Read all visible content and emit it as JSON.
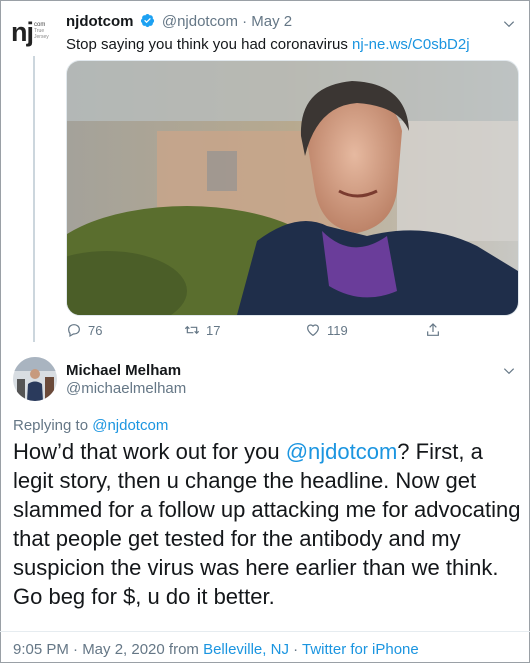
{
  "parent_tweet": {
    "avatar_letters": "nj",
    "avatar_small": "com",
    "avatar_caption": "True Jersey",
    "display_name": "njdotcom",
    "handle": "@njdotcom",
    "separator": "·",
    "date": "May 2",
    "text": "Stop saying you think you had coronavirus ",
    "link": "nj-ne.ws/C0sbD2j",
    "replies": "76",
    "retweets": "17",
    "likes": "119",
    "icons": [
      "verified-badge-icon",
      "chevron-down-icon",
      "reply-icon",
      "retweet-icon",
      "like-icon",
      "share-icon"
    ]
  },
  "main_tweet": {
    "display_name": "Michael Melham",
    "handle": "@michaelmelham",
    "replying_label": "Replying to ",
    "replying_handle": "@njdotcom",
    "body_pre": "How’d that work out for you ",
    "body_mention": "@njdotcom",
    "body_post": "? First, a legit story, then u change the headline.  Now get slammed for a follow up attacking me for advocating that people get tested for the antibody and my suspicion the virus was here earlier than we think.",
    "body_line2": "Go beg for $, u do it better.",
    "time": "9:05 PM · May 2, 2020 from ",
    "location": "Belleville, NJ",
    "dot": " · ",
    "source": "Twitter for iPhone"
  },
  "colors": {
    "link": "#1b95e0",
    "muted": "#657786",
    "text": "#14171a",
    "divider": "#e6ecf0"
  }
}
